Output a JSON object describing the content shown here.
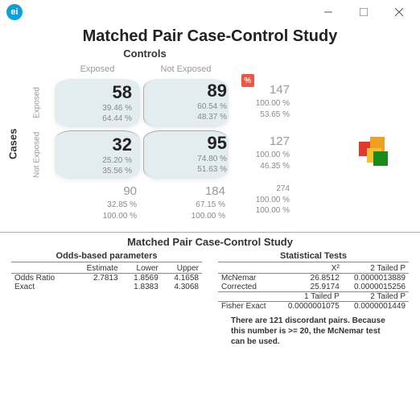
{
  "titlebar": {
    "logo": "ei"
  },
  "title": "Matched Pair Case-Control Study",
  "labels": {
    "controls": "Controls",
    "cases": "Cases",
    "exposed": "Exposed",
    "not_exposed": "Not Exposed"
  },
  "cells": {
    "ee": {
      "n": "58",
      "p1": "39.46 %",
      "p2": "64.44 %"
    },
    "en": {
      "n": "89",
      "p1": "60.54 %",
      "p2": "48.37 %"
    },
    "ne": {
      "n": "32",
      "p1": "25.20 %",
      "p2": "35.56 %"
    },
    "nn": {
      "n": "95",
      "p1": "74.80 %",
      "p2": "51.63 %"
    }
  },
  "row_marg": {
    "r1": {
      "n": "147",
      "p1": "100.00 %",
      "p2": "53.65 %"
    },
    "r2": {
      "n": "127",
      "p1": "100.00 %",
      "p2": "46.35 %"
    }
  },
  "col_marg": {
    "c1": {
      "n": "90",
      "p1": "32.85 %",
      "p2": "100.00 %"
    },
    "c2": {
      "n": "184",
      "p1": "67.15 %",
      "p2": "100.00 %"
    },
    "tot": {
      "n": "274",
      "p1": "100.00 %",
      "p2": "100.00 %"
    }
  },
  "subtitle": "Matched Pair Case-Control Study",
  "odds": {
    "header": "Odds-based parameters",
    "cols": {
      "est": "Estimate",
      "low": "Lower",
      "up": "Upper"
    },
    "rows": [
      {
        "label": "Odds Ratio",
        "est": "2.7813",
        "low": "1.8569",
        "up": "4.1658"
      },
      {
        "label": "Exact",
        "est": "",
        "low": "1.8383",
        "up": "4.3068"
      }
    ]
  },
  "stats": {
    "header": "Statistical Tests",
    "cols": {
      "x2": "X²",
      "p2": "2 Tailed P"
    },
    "rows": [
      {
        "label": "McNemar",
        "x2": "26.8512",
        "p2": "0.0000013889"
      },
      {
        "label": "Corrected",
        "x2": "25.9174",
        "p2": "0.0000015256"
      }
    ],
    "cols2": {
      "p1": "1 Tailed P",
      "p2b": "2 Tailed P"
    },
    "rows2": [
      {
        "label": "Fisher Exact",
        "p1": "0.0000001075",
        "p2": "0.0000001449"
      }
    ]
  },
  "note": "There are 121 discordant pairs.  Because this number is  >= 20, the McNemar test can be used."
}
